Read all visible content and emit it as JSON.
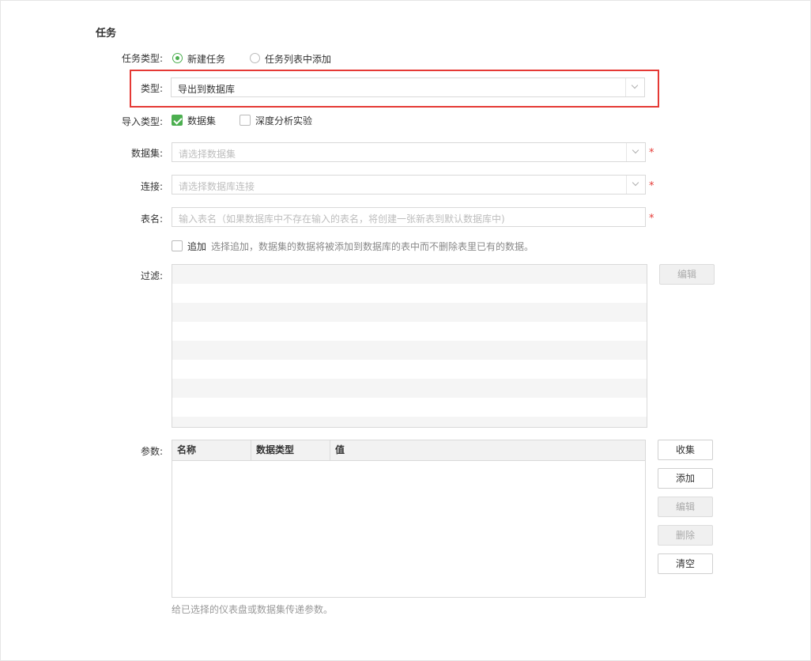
{
  "section": {
    "title": "任务"
  },
  "task_type": {
    "label": "任务类型:",
    "options": [
      "新建任务",
      "任务列表中添加"
    ],
    "selected": "新建任务"
  },
  "type": {
    "label": "类型:",
    "value": "导出到数据库"
  },
  "import_type": {
    "label": "导入类型:",
    "options": [
      {
        "label": "数据集",
        "checked": true
      },
      {
        "label": "深度分析实验",
        "checked": false
      }
    ]
  },
  "dataset": {
    "label": "数据集:",
    "placeholder": "请选择数据集",
    "required_mark": "*"
  },
  "connection": {
    "label": "连接:",
    "placeholder": "请选择数据库连接",
    "required_mark": "*"
  },
  "table_name": {
    "label": "表名:",
    "placeholder": "输入表名（如果数据库中不存在输入的表名，将创建一张新表到默认数据库中)",
    "required_mark": "*"
  },
  "append": {
    "label": "追加",
    "hint": "选择追加，数据集的数据将被添加到数据库的表中而不删除表里已有的数据。",
    "checked": false
  },
  "filter": {
    "label": "过滤:",
    "edit_button": "编辑"
  },
  "params": {
    "label": "参数:",
    "columns": [
      "名称",
      "数据类型",
      "值"
    ],
    "rows": [],
    "buttons": {
      "collect": "收集",
      "add": "添加",
      "edit": "编辑",
      "delete": "删除",
      "clear": "清空"
    },
    "note": "给已选择的仪表盘或数据集传递参数。"
  },
  "colors": {
    "accent": "#4caf50",
    "highlight": "#e53935",
    "required": "#e53935"
  }
}
